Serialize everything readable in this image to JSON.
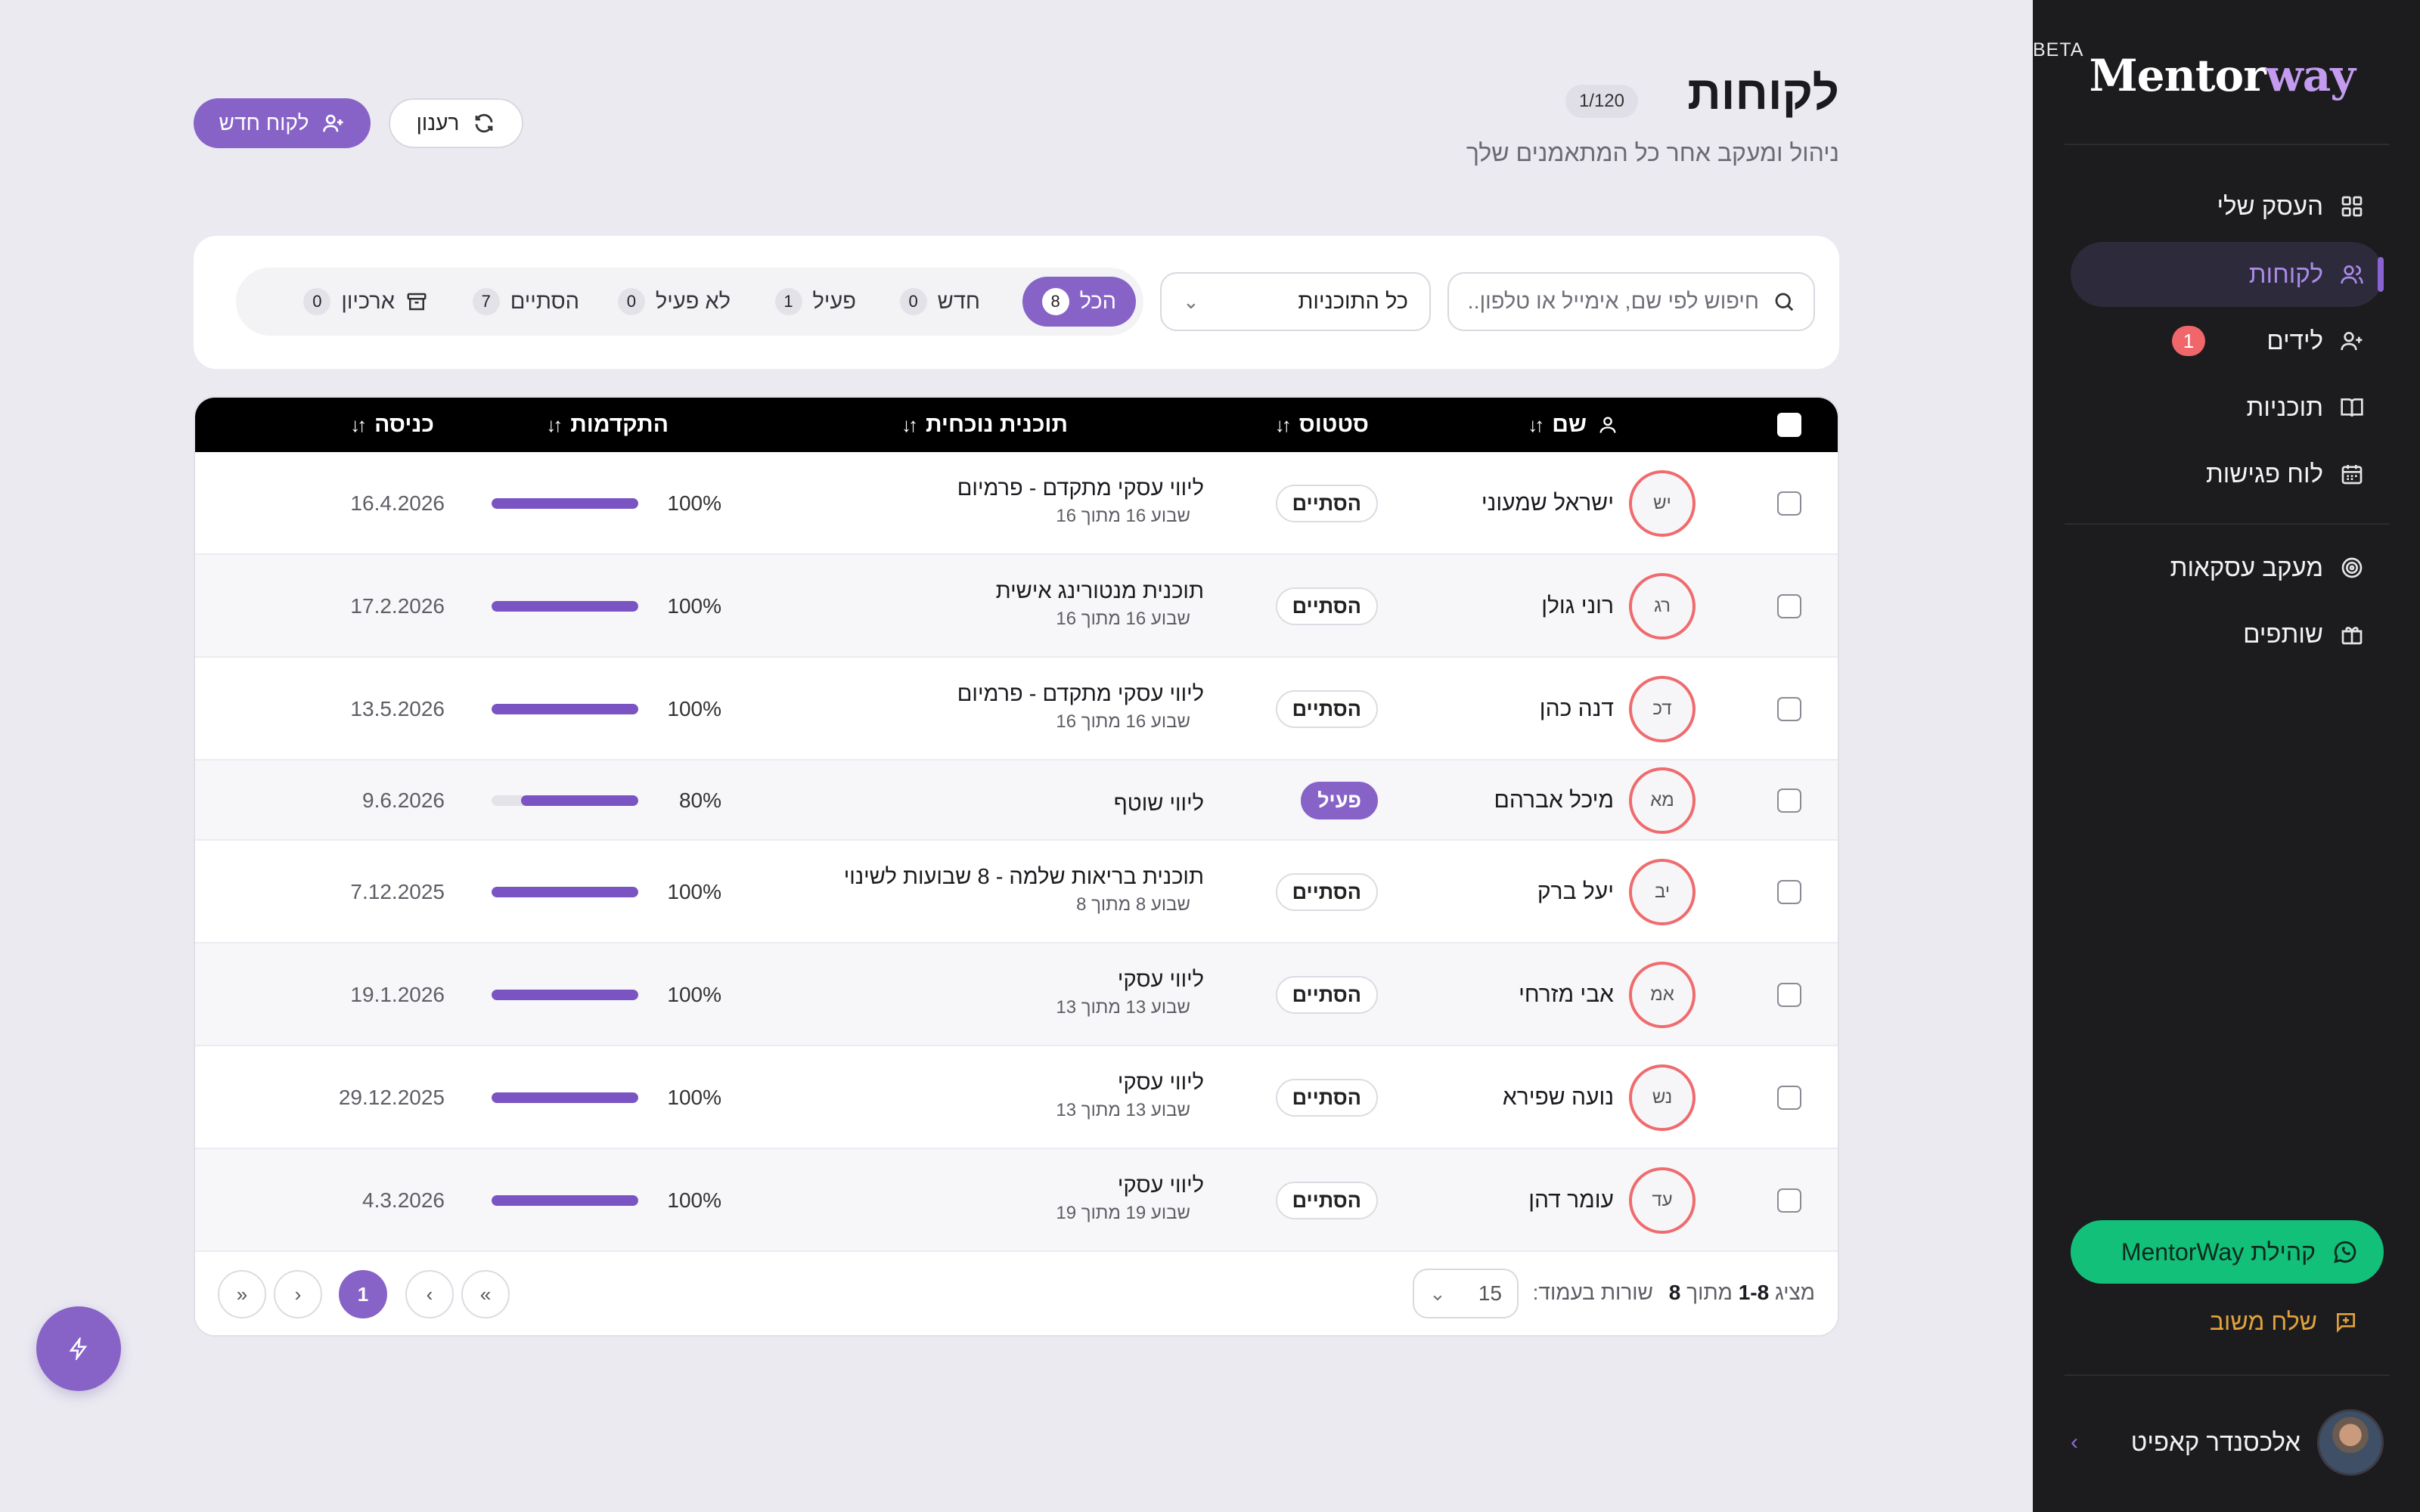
{
  "sidebar": {
    "logo_part1": "Mentor",
    "logo_part2": "way",
    "beta": "BETA",
    "items": [
      {
        "label": "העסק שלי"
      },
      {
        "label": "לקוחות"
      },
      {
        "label": "לידים",
        "badge": "1"
      },
      {
        "label": "תוכניות"
      },
      {
        "label": "לוח פגישות"
      },
      {
        "label": "מעקב עסקאות"
      },
      {
        "label": "שותפים"
      }
    ],
    "community_label": "קהילת MentorWay",
    "feedback_label": "שלח משוב",
    "user_name": "אלכסנדר קאפיט"
  },
  "header": {
    "title": "לקוחות",
    "count": "1/120",
    "subtitle": "ניהול ומעקב אחר כל המתאמנים שלך",
    "new_client_label": "לקוח חדש",
    "refresh_label": "רענון"
  },
  "filters": {
    "search_placeholder": "חיפוש לפי שם, אימייל או טלפון..",
    "plan_select": "כל התוכניות",
    "tabs": [
      {
        "label": "הכל",
        "count": "8"
      },
      {
        "label": "חדש",
        "count": "0"
      },
      {
        "label": "פעיל",
        "count": "1"
      },
      {
        "label": "לא פעיל",
        "count": "0"
      },
      {
        "label": "הסתיים",
        "count": "7"
      },
      {
        "label": "ארכיון",
        "count": "0"
      }
    ]
  },
  "table": {
    "columns": {
      "name": "שם",
      "status": "סטטוס",
      "plan": "תוכנית נוכחית",
      "progress": "התקדמות",
      "entry": "כניסה"
    },
    "rows": [
      {
        "initials": "יש",
        "name": "ישראל שמעוני",
        "status": "הסתיים",
        "plan": "ליווי עסקי מתקדם - פרמיום",
        "week": "שבוע 16 מתוך 16",
        "progress_label": "100%",
        "progress": 100,
        "entry": "16.4.2026"
      },
      {
        "initials": "רג",
        "name": "רוני גולן",
        "status": "הסתיים",
        "plan": "תוכנית מנטורינג אישית",
        "week": "שבוע 16 מתוך 16",
        "progress_label": "100%",
        "progress": 100,
        "entry": "17.2.2026"
      },
      {
        "initials": "דכ",
        "name": "דנה כהן",
        "status": "הסתיים",
        "plan": "ליווי עסקי מתקדם - פרמיום",
        "week": "שבוע 16 מתוך 16",
        "progress_label": "100%",
        "progress": 100,
        "entry": "13.5.2026"
      },
      {
        "initials": "מא",
        "name": "מיכל אברהם",
        "status": "פעיל",
        "plan": "ליווי שוטף",
        "week": "",
        "progress_label": "80%",
        "progress": 80,
        "entry": "9.6.2026"
      },
      {
        "initials": "יב",
        "name": "יעל ברק",
        "status": "הסתיים",
        "plan": "תוכנית בריאות שלמה - 8 שבועות לשינוי",
        "week": "שבוע 8 מתוך 8",
        "progress_label": "100%",
        "progress": 100,
        "entry": "7.12.2025"
      },
      {
        "initials": "אמ",
        "name": "אבי מזרחי",
        "status": "הסתיים",
        "plan": "ליווי עסקי",
        "week": "שבוע 13 מתוך 13",
        "progress_label": "100%",
        "progress": 100,
        "entry": "19.1.2026"
      },
      {
        "initials": "נש",
        "name": "נועה שפירא",
        "status": "הסתיים",
        "plan": "ליווי עסקי",
        "week": "שבוע 13 מתוך 13",
        "progress_label": "100%",
        "progress": 100,
        "entry": "29.12.2025"
      },
      {
        "initials": "עד",
        "name": "עומר דהן",
        "status": "הסתיים",
        "plan": "ליווי עסקי",
        "week": "שבוע 19 מתוך 19",
        "progress_label": "100%",
        "progress": 100,
        "entry": "4.3.2026"
      }
    ]
  },
  "pagination": {
    "showing_prefix": "מציג",
    "showing_range": "1-8",
    "showing_of": "מתוך",
    "total": "8",
    "rows_per_page_label": "שורות בעמוד:",
    "rows_per_page": "15",
    "current_page": "1"
  },
  "colors": {
    "accent": "#8763c8",
    "sidebar_bg": "#1c1c1e",
    "community_green": "#12c07a",
    "avatar_ring": "#ef6b6e",
    "feedback_orange": "#e2a23b"
  }
}
